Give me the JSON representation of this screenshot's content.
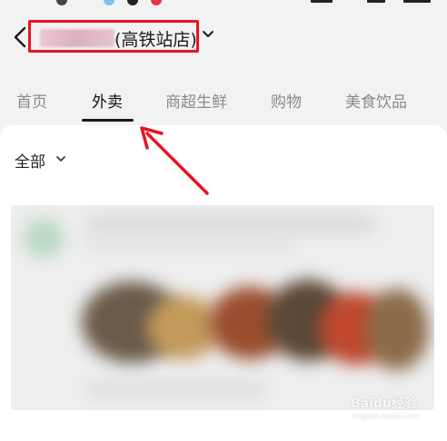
{
  "header": {
    "store_suffix": "(高铁站店)",
    "store_name_blurred": true
  },
  "tabs": [
    {
      "label": "首页",
      "active": false
    },
    {
      "label": "外卖",
      "active": true
    },
    {
      "label": "商超生鲜",
      "active": false
    },
    {
      "label": "购物",
      "active": false
    },
    {
      "label": "美食饮品",
      "active": false
    }
  ],
  "filter": {
    "label": "全部"
  },
  "watermark": {
    "text": "Baidu经验",
    "sub": "jingyan.baidu.com"
  },
  "colors": {
    "annotation": "#e8141f",
    "active_tab": "#111111",
    "inactive_tab": "#8a8a8a"
  }
}
